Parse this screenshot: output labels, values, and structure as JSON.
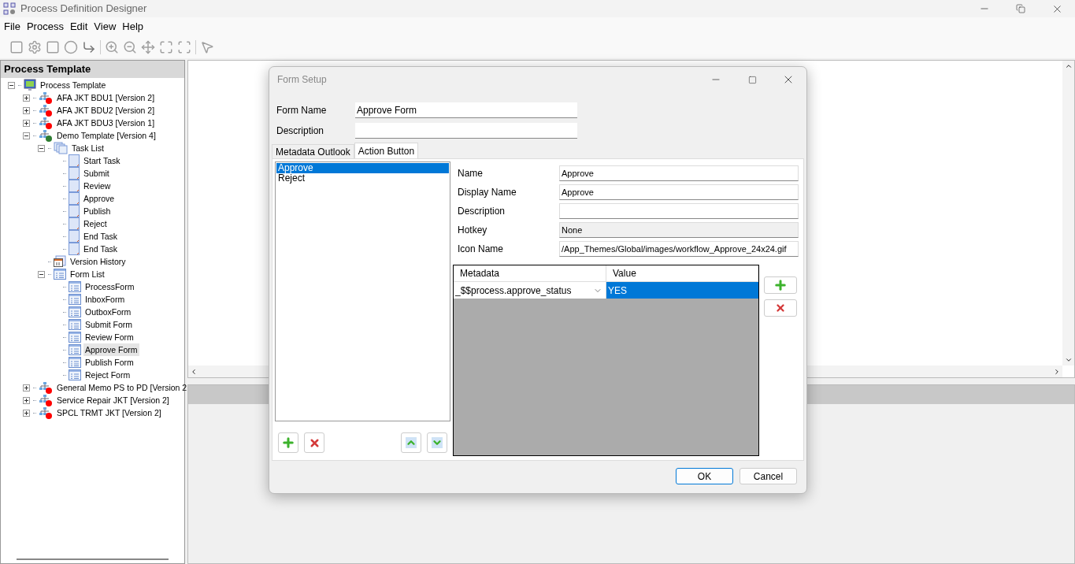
{
  "window": {
    "title": "Process Definition Designer"
  },
  "menu": [
    "File",
    "Process",
    "Edit",
    "View",
    "Help"
  ],
  "left_panel": {
    "title": "Process Template",
    "tree": [
      {
        "label": "Process Template",
        "kind": "template",
        "expanded": true,
        "selected": false,
        "children": [
          {
            "label": "AFA JKT BDU1 [Version 2]",
            "kind": "process",
            "color": "#ff0000",
            "expanded": false,
            "selected": false
          },
          {
            "label": "AFA JKT BDU2 [Version 2]",
            "kind": "process",
            "color": "#ff0000",
            "expanded": false,
            "selected": false
          },
          {
            "label": "AFA JKT BDU3 [Version 1]",
            "kind": "process",
            "color": "#ff0000",
            "expanded": false,
            "selected": false
          },
          {
            "label": "Demo Template [Version 4]",
            "kind": "process",
            "color": "#2e7d32",
            "expanded": true,
            "selected": false,
            "children": [
              {
                "label": "Task List",
                "kind": "task-list",
                "expanded": true,
                "selected": false,
                "children": [
                  {
                    "label": "Start Task",
                    "kind": "task",
                    "selected": false
                  },
                  {
                    "label": "Submit",
                    "kind": "task",
                    "selected": false
                  },
                  {
                    "label": "Review",
                    "kind": "task",
                    "selected": false
                  },
                  {
                    "label": "Approve",
                    "kind": "task",
                    "selected": false
                  },
                  {
                    "label": "Publish",
                    "kind": "task",
                    "selected": false
                  },
                  {
                    "label": "Reject",
                    "kind": "task",
                    "selected": false
                  },
                  {
                    "label": "End Task",
                    "kind": "task",
                    "selected": false
                  },
                  {
                    "label": "End Task",
                    "kind": "task",
                    "selected": false
                  }
                ]
              },
              {
                "label": "Version History",
                "kind": "history",
                "selected": false
              },
              {
                "label": "Form List",
                "kind": "form-list",
                "expanded": true,
                "selected": false,
                "children": [
                  {
                    "label": "ProcessForm",
                    "kind": "form",
                    "selected": false
                  },
                  {
                    "label": "InboxForm",
                    "kind": "form",
                    "selected": false
                  },
                  {
                    "label": "OutboxForm",
                    "kind": "form",
                    "selected": false
                  },
                  {
                    "label": "Submit Form",
                    "kind": "form",
                    "selected": false
                  },
                  {
                    "label": "Review Form",
                    "kind": "form",
                    "selected": false
                  },
                  {
                    "label": "Approve Form",
                    "kind": "form",
                    "selected": true
                  },
                  {
                    "label": "Publish Form",
                    "kind": "form",
                    "selected": false
                  },
                  {
                    "label": "Reject Form",
                    "kind": "form",
                    "selected": false
                  }
                ]
              }
            ]
          },
          {
            "label": "General Memo PS to PD [Version 2",
            "kind": "process",
            "color": "#ff0000",
            "expanded": false,
            "selected": false
          },
          {
            "label": "Service Repair JKT [Version 2]",
            "kind": "process",
            "color": "#ff0000",
            "expanded": false,
            "selected": false
          },
          {
            "label": "SPCL TRMT JKT [Version 2]",
            "kind": "process",
            "color": "#ff0000",
            "expanded": false,
            "selected": false
          }
        ]
      }
    ]
  },
  "dialog": {
    "title": "Form Setup",
    "form_name": {
      "label": "Form Name",
      "value": "Approve Form"
    },
    "description": {
      "label": "Description"
    },
    "tabs": [
      {
        "label": "Metadata Outlook",
        "selected": false
      },
      {
        "label": "Action Button",
        "selected": true
      }
    ],
    "action_list": [
      {
        "label": "Approve",
        "selected": true
      },
      {
        "label": "Reject",
        "selected": false
      }
    ],
    "fields": [
      {
        "label": "Name",
        "value": "Approve",
        "disabled": false
      },
      {
        "label": "Display Name",
        "value": "Approve",
        "disabled": false
      },
      {
        "label": "Description",
        "disabled": false
      },
      {
        "label": "Hotkey",
        "value": "None",
        "disabled": true
      },
      {
        "label": "Icon Name",
        "value": "/App_Themes/Global/images/workflow_Approve_24x24.gif",
        "disabled": false
      }
    ],
    "grid": {
      "columns": [
        "Metadata",
        "Value"
      ],
      "rows": [
        {
          "metadata": "_$$process.approve_status",
          "value": "YES",
          "selected": true
        }
      ]
    },
    "buttons": [
      "OK",
      "Cancel"
    ]
  }
}
